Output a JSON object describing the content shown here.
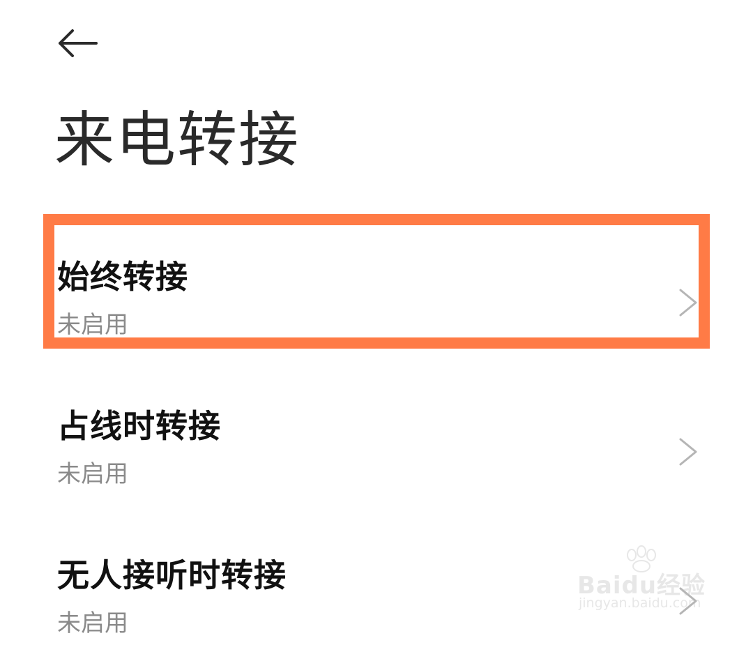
{
  "header": {
    "back_icon": "arrow-left-icon",
    "title": "来电转接"
  },
  "items": [
    {
      "title": "始终转接",
      "subtitle": "未启用",
      "chevron_icon": "chevron-right-icon",
      "highlighted": true
    },
    {
      "title": "占线时转接",
      "subtitle": "未启用",
      "chevron_icon": "chevron-right-icon"
    },
    {
      "title": "无人接听时转接",
      "subtitle": "未启用",
      "chevron_icon": "chevron-right-icon"
    }
  ],
  "annotation": {
    "highlight_color": "#ff7b46"
  },
  "watermark": {
    "brand": "Baidu经验",
    "url": "jingyan.baidu.com"
  }
}
